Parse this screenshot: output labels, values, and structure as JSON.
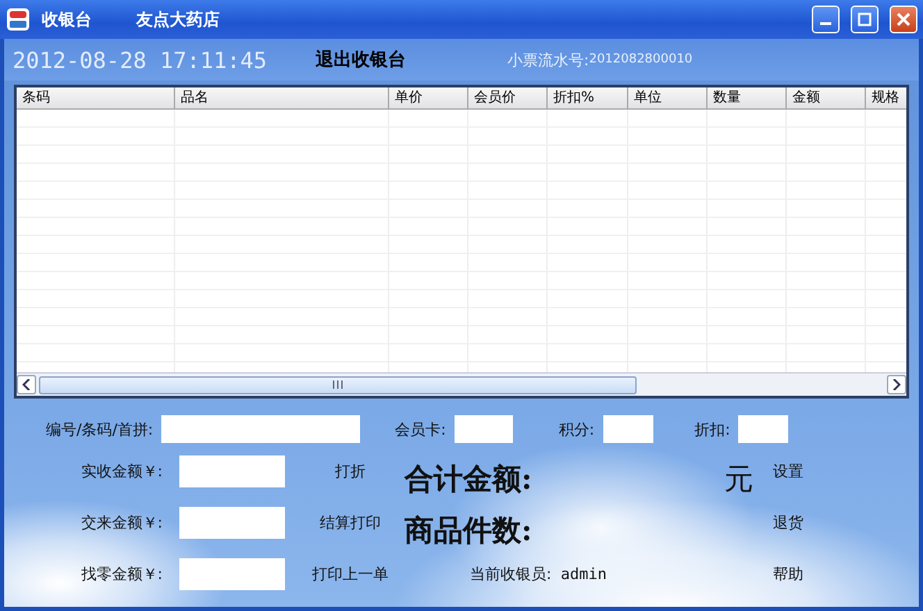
{
  "window": {
    "title": "收银台",
    "store_name": "友点大药店"
  },
  "header": {
    "datetime": "2012-08-28 17:11:45",
    "exit_button": "退出收银台",
    "receipt_label": "小票流水号:",
    "receipt_number": "2012082800010"
  },
  "table": {
    "columns": [
      "条码",
      "品名",
      "单价",
      "会员价",
      "折扣%",
      "单位",
      "数量",
      "金额",
      "规格"
    ]
  },
  "search_row": [
    {
      "label": "编号/条码/首拼:"
    },
    {
      "label": "会员卡:"
    },
    {
      "label": "积分:"
    },
    {
      "label": "折扣:"
    }
  ],
  "payment_rows": [
    {
      "label": "实收金额￥:",
      "button": "打折"
    },
    {
      "label": "交来金额￥:",
      "button": "结算打印"
    },
    {
      "label": "找零金额￥:",
      "button": "打印上一单"
    }
  ],
  "summary": {
    "total_label": "合计金额:",
    "currency": "元",
    "count_label": "商品件数:",
    "cashier_label": "当前收银员:",
    "cashier": "admin"
  },
  "side_buttons": [
    "设置",
    "退货",
    "帮助"
  ]
}
